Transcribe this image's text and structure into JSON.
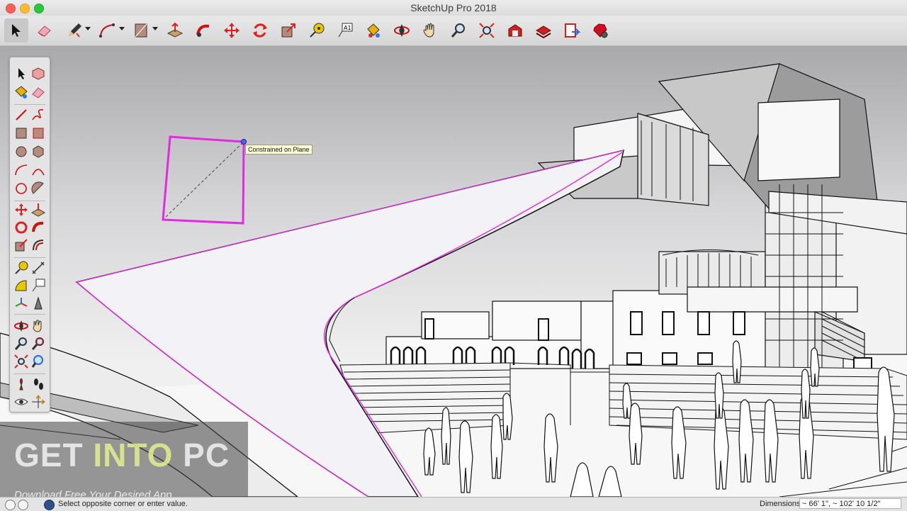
{
  "window": {
    "title": "SketchUp Pro 2018"
  },
  "toolbar": {
    "tools": [
      "select-tool",
      "eraser-tool",
      "pencil-tool",
      "arc-tool",
      "rectangle-tool",
      "push-pull-tool",
      "follow-me-tool",
      "move-tool",
      "rotate-tool",
      "scale-tool",
      "tape-measure-tool",
      "text-tool",
      "paint-bucket-tool",
      "orbit-tool",
      "pan-tool",
      "zoom-tool",
      "zoom-extents-tool",
      "3d-warehouse-tool",
      "extension-warehouse-tool",
      "layout-tool",
      "extension-manager-tool"
    ]
  },
  "canvas": {
    "tooltip": "Constrained on Plane"
  },
  "watermark": {
    "get": "GET ",
    "into": "INTO",
    "pc": " PC",
    "tagline": "Download Free Your Desired App"
  },
  "status": {
    "hint": "Select opposite corner or enter value.",
    "measurements_label": "Dimensions",
    "measurements_value": "~ 66' 1\", ~ 102' 10 1/2\""
  },
  "colors": {
    "selection": "#e22be0",
    "inference": "#5560ff",
    "tooltip_bg": "#fdfdd8"
  }
}
